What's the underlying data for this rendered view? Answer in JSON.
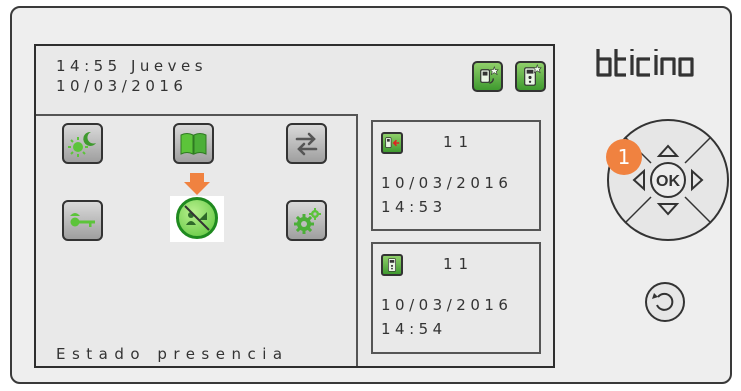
{
  "brand": {
    "logo_text": "bticino"
  },
  "header": {
    "time_day": "14:55 Jueves",
    "date": "10/03/2016"
  },
  "header_icons": [
    {
      "name": "intercom-call-icon",
      "color": "#4caf38"
    },
    {
      "name": "entrance-panel-icon",
      "color": "#4caf38"
    }
  ],
  "grid_icons": [
    {
      "name": "day-night-icon"
    },
    {
      "name": "address-book-icon"
    },
    {
      "name": "transfer-arrows-icon"
    },
    {
      "name": "door-key-icon"
    },
    {
      "name": "presence-status-icon",
      "selected": true
    },
    {
      "name": "settings-gears-icon"
    }
  ],
  "footer": {
    "label": "Estado presencia"
  },
  "notifications": [
    {
      "icon": "missed-intercom-call-icon",
      "count": "11",
      "date": "10/03/2016",
      "time": "14:53"
    },
    {
      "icon": "entrance-panel-icon",
      "count": "11",
      "date": "10/03/2016",
      "time": "14:54"
    }
  ],
  "keypad": {
    "ok_label": "OK",
    "step_marker": "1"
  },
  "colors": {
    "accent_orange": "#f08240",
    "icon_green": "#4caf38",
    "screen_bg": "#e9e9e9"
  }
}
